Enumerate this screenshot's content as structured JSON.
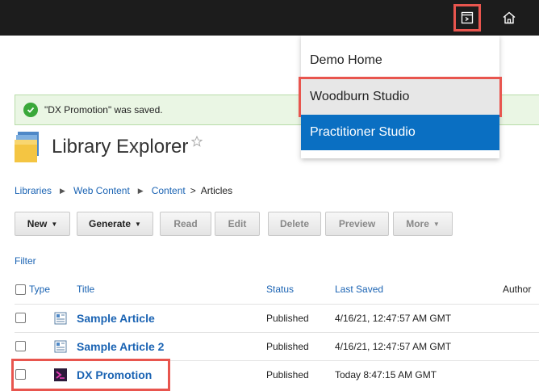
{
  "topbar": {
    "studio_icon": "studio-switcher-icon",
    "home_icon": "home-icon"
  },
  "dropdown": {
    "items": [
      "Demo Home",
      "Woodburn Studio",
      "Practitioner Studio"
    ]
  },
  "message": {
    "text": "\"DX Promotion\" was saved.",
    "icon": "check-circle-icon"
  },
  "page": {
    "title": "Library Explorer",
    "icon": "library-folder-icon"
  },
  "breadcrumb": {
    "libraries": "Libraries",
    "web_content": "Web Content",
    "content": "Content",
    "separator": ">",
    "current": "Articles"
  },
  "toolbar": {
    "new": "New",
    "generate": "Generate",
    "read": "Read",
    "edit": "Edit",
    "delete": "Delete",
    "preview": "Preview",
    "more": "More"
  },
  "filter": "Filter",
  "table": {
    "columns": {
      "type": "Type",
      "title": "Title",
      "status": "Status",
      "last_saved": "Last Saved",
      "author": "Author"
    },
    "rows": [
      {
        "title": "Sample Article",
        "status": "Published",
        "last_saved": "4/16/21, 12:47:57 AM GMT",
        "type_icon": "article-icon"
      },
      {
        "title": "Sample Article 2",
        "status": "Published",
        "last_saved": "4/16/21, 12:47:57 AM GMT",
        "type_icon": "article-icon"
      },
      {
        "title": "DX Promotion",
        "status": "Published",
        "last_saved": "Today 8:47:15 AM GMT",
        "type_icon": "dx-promotion-icon"
      }
    ]
  },
  "colors": {
    "link": "#1a63b3",
    "highlight": "#e8554e",
    "active": "#0a6fc2",
    "success_bg": "#eaf6e4"
  }
}
